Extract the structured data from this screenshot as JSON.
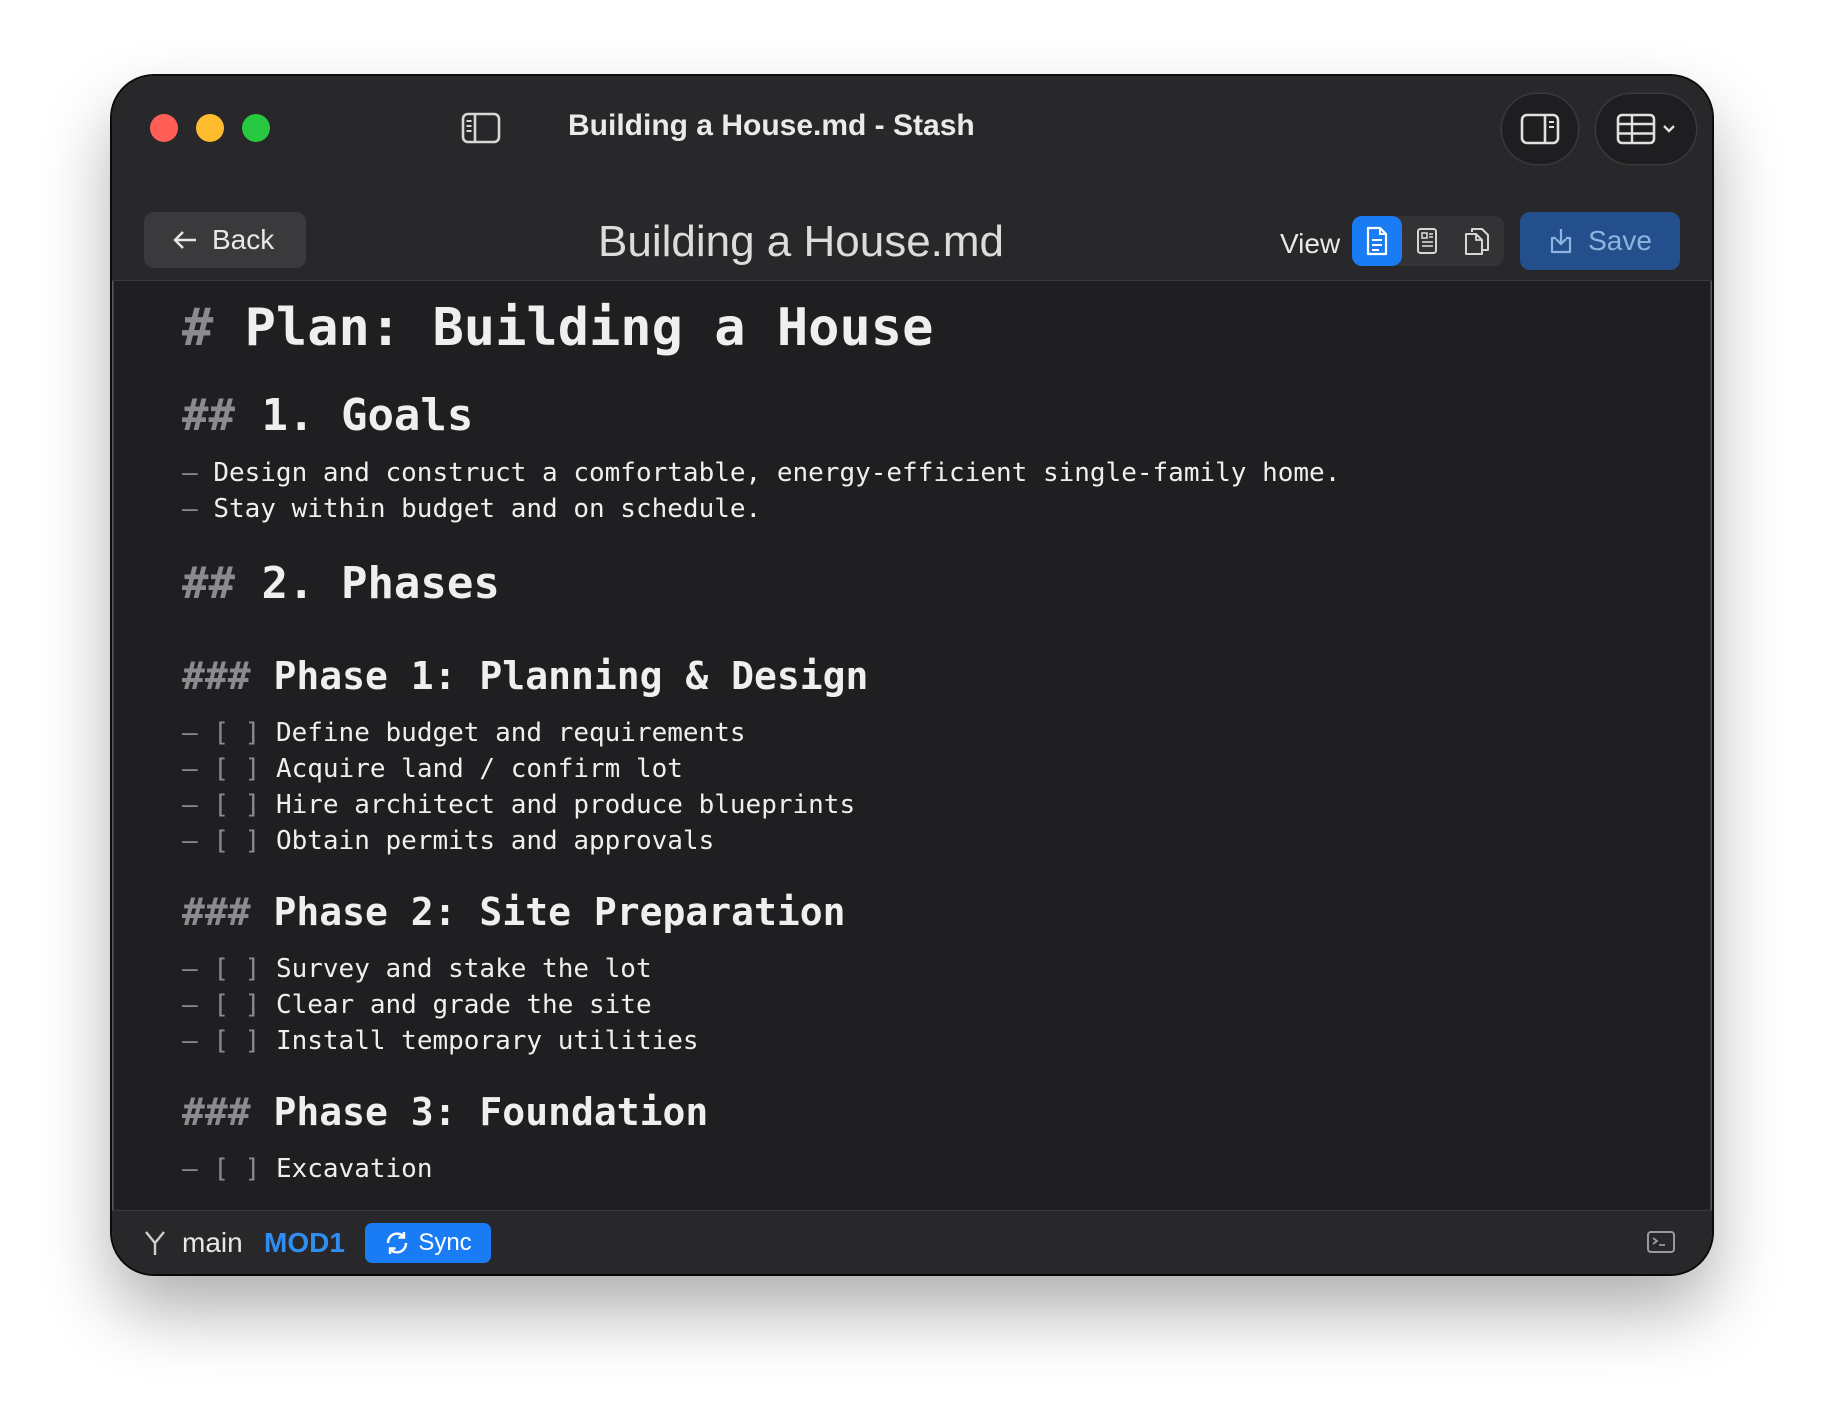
{
  "window": {
    "title": "Building a House.md - Stash"
  },
  "toolbar": {
    "back_label": "Back",
    "doc_title": "Building a House.md",
    "view_label": "View",
    "save_label": "Save",
    "view_modes": [
      "document-icon",
      "preview-icon",
      "copy-icon"
    ],
    "active_view": "document-icon"
  },
  "document": {
    "h1": {
      "marker": "#",
      "text": "Plan: Building a House"
    },
    "goals": {
      "marker": "##",
      "text": "1. Goals",
      "items": [
        "Design and construct a comfortable, energy-efficient single-family home.",
        "Stay within budget and on schedule."
      ]
    },
    "phases": {
      "marker": "##",
      "text": "2. Phases"
    },
    "phase1": {
      "marker": "###",
      "text": "Phase 1: Planning & Design",
      "items": [
        "Define budget and requirements",
        "Acquire land / confirm lot",
        "Hire architect and produce blueprints",
        "Obtain permits and approvals"
      ]
    },
    "phase2": {
      "marker": "###",
      "text": "Phase 2: Site Preparation",
      "items": [
        "Survey and stake the lot",
        "Clear and grade the site",
        "Install temporary utilities"
      ]
    },
    "phase3": {
      "marker": "###",
      "text": "Phase 3: Foundation",
      "items": [
        "Excavation"
      ]
    },
    "bullet": "–",
    "checkbox": "[ ]"
  },
  "status": {
    "branch": "main",
    "modified": "MOD1",
    "sync_label": "Sync"
  },
  "colors": {
    "accent": "#1a7cf5",
    "window_bg": "#1f1f21",
    "markdown_marker": "#8b8b8e"
  }
}
